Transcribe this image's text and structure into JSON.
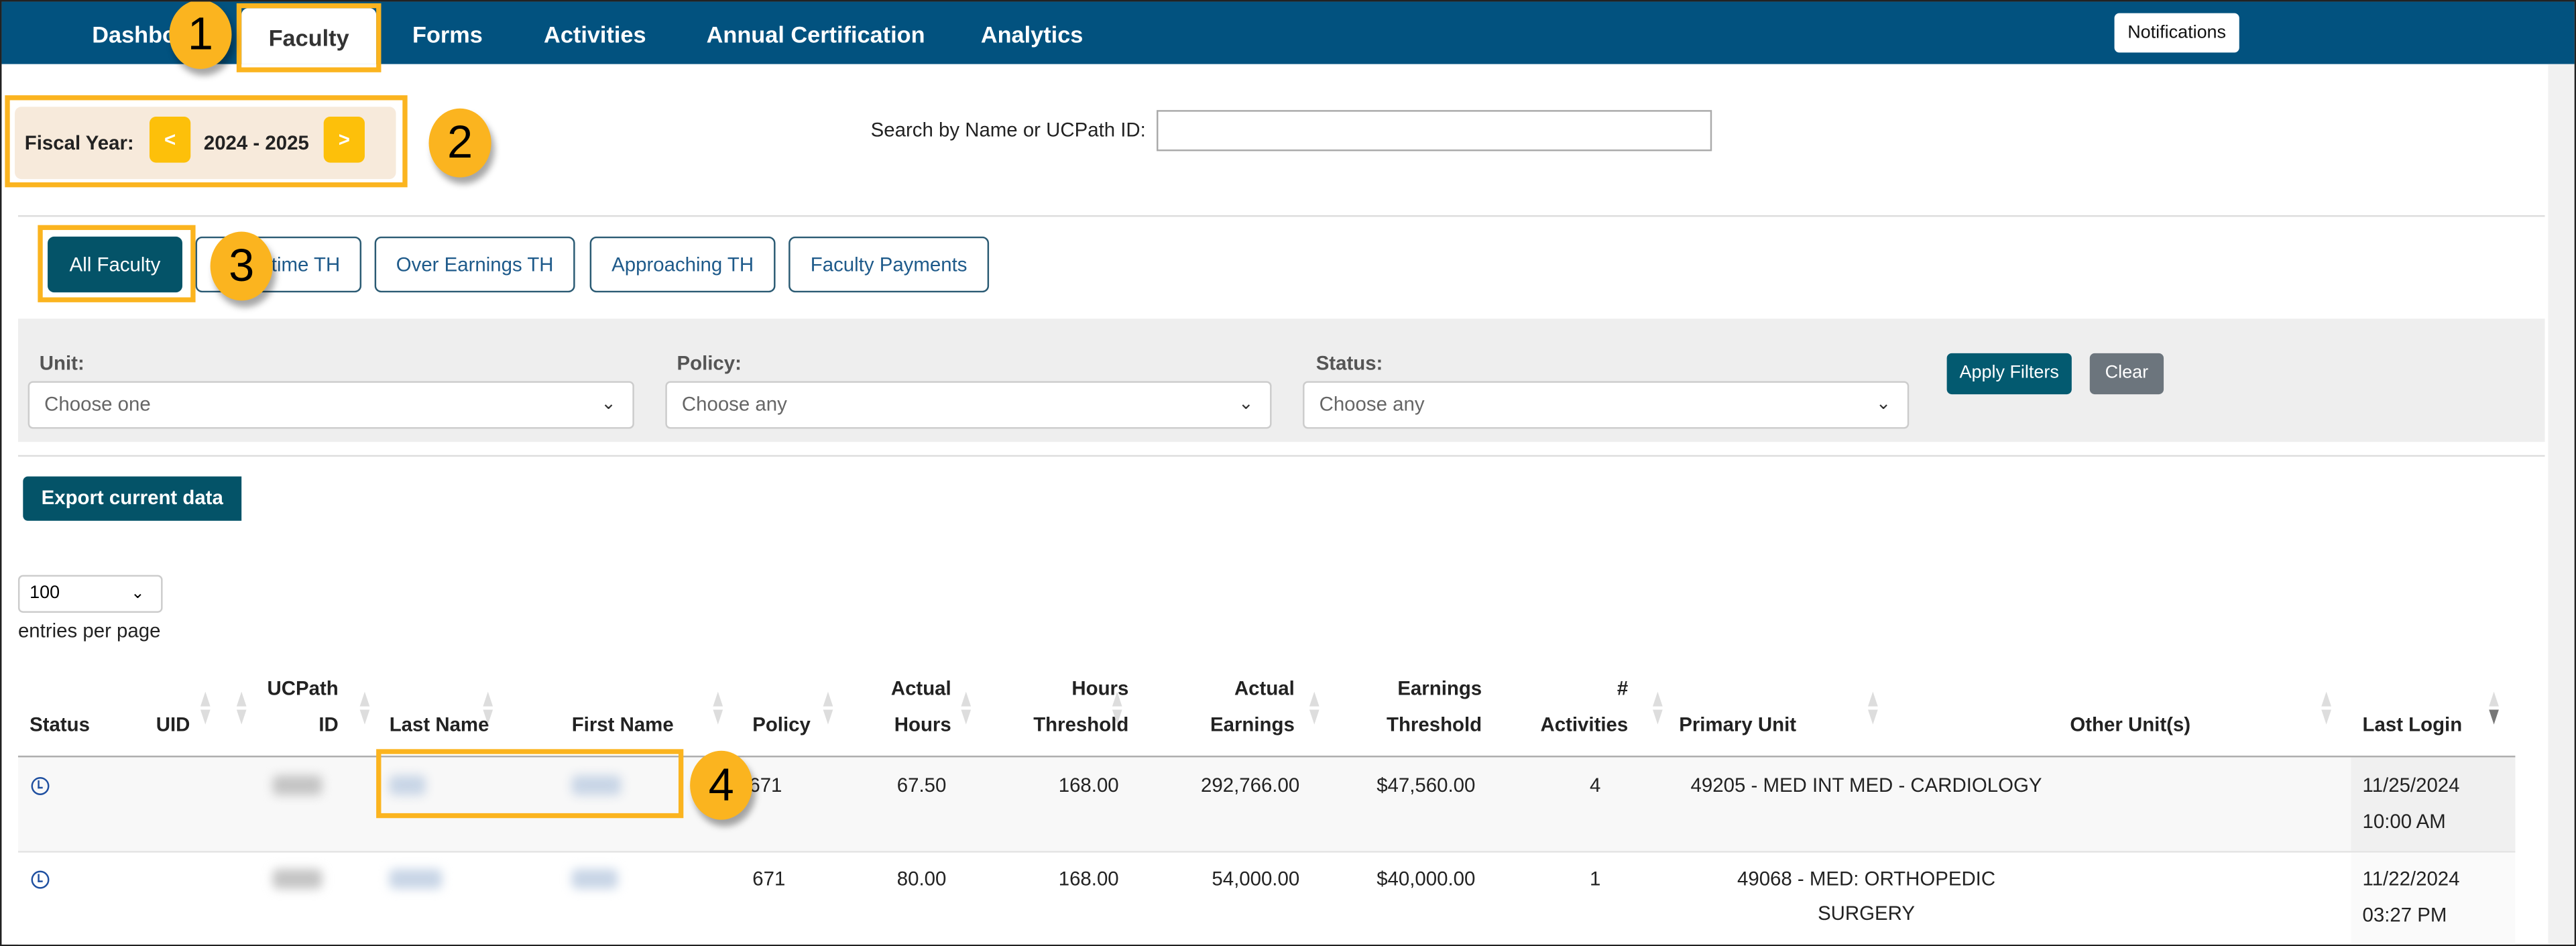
{
  "nav": {
    "tabs": [
      {
        "label": "Dashboard",
        "active": false
      },
      {
        "label": "Faculty",
        "active": true
      },
      {
        "label": "Forms",
        "active": false
      },
      {
        "label": "Activities",
        "active": false
      },
      {
        "label": "Annual Certification",
        "active": false
      },
      {
        "label": "Analytics",
        "active": false
      }
    ],
    "notifications_label": "Notifications",
    "color": "#02527f"
  },
  "callouts": [
    "1",
    "2",
    "3",
    "4"
  ],
  "fiscal_year": {
    "label": "Fiscal Year:",
    "prev": "<",
    "value": "2024 - 2025",
    "next": ">"
  },
  "search": {
    "label": "Search by Name or UCPath ID:",
    "value": ""
  },
  "view_tabs": [
    {
      "label": "All Faculty",
      "active": true
    },
    {
      "label": "Overtime TH",
      "active": false
    },
    {
      "label": "Over Earnings TH",
      "active": false
    },
    {
      "label": "Approaching TH",
      "active": false
    },
    {
      "label": "Faculty Payments",
      "active": false
    }
  ],
  "filters": {
    "unit": {
      "label": "Unit:",
      "value": "Choose one"
    },
    "policy": {
      "label": "Policy:",
      "value": "Choose any"
    },
    "status": {
      "label": "Status:",
      "value": "Choose any"
    },
    "apply_label": "Apply Filters",
    "clear_label": "Clear"
  },
  "export_label": "Export current data",
  "page_size": {
    "value": "100",
    "label": "entries per page"
  },
  "table": {
    "columns": [
      [
        "",
        "Status"
      ],
      [
        "",
        "UID"
      ],
      [
        "UCPath",
        "ID"
      ],
      [
        "",
        "Last Name"
      ],
      [
        "",
        "First Name"
      ],
      [
        "",
        "Policy"
      ],
      [
        "Actual",
        "Hours"
      ],
      [
        "Hours",
        "Threshold"
      ],
      [
        "Actual",
        "Earnings"
      ],
      [
        "Earnings",
        "Threshold"
      ],
      [
        "#",
        "Activities"
      ],
      [
        "",
        "Primary Unit"
      ],
      [
        "",
        "Other Unit(s)"
      ],
      [
        "",
        "Last Login"
      ]
    ],
    "sorted_column": "Last Login",
    "sort_direction": "descending",
    "rows": [
      {
        "status_icon": "clock-icon",
        "policy": "671",
        "actual_hours": "67.50",
        "hours_threshold": "168.00",
        "actual_earnings": "292,766.00",
        "earnings_threshold": "$47,560.00",
        "activities": "4",
        "primary_unit": [
          "49205 - MED INT MED - CARDIOLOGY"
        ],
        "other_units": "",
        "last_login": [
          "11/25/2024",
          "10:00 AM"
        ]
      },
      {
        "status_icon": "clock-icon",
        "policy": "671",
        "actual_hours": "80.00",
        "hours_threshold": "168.00",
        "actual_earnings": "54,000.00",
        "earnings_threshold": "$40,000.00",
        "activities": "1",
        "primary_unit": [
          "49068 - MED: ORTHOPEDIC",
          "SURGERY"
        ],
        "other_units": "",
        "last_login": [
          "11/22/2024",
          "03:27 PM"
        ]
      }
    ]
  }
}
